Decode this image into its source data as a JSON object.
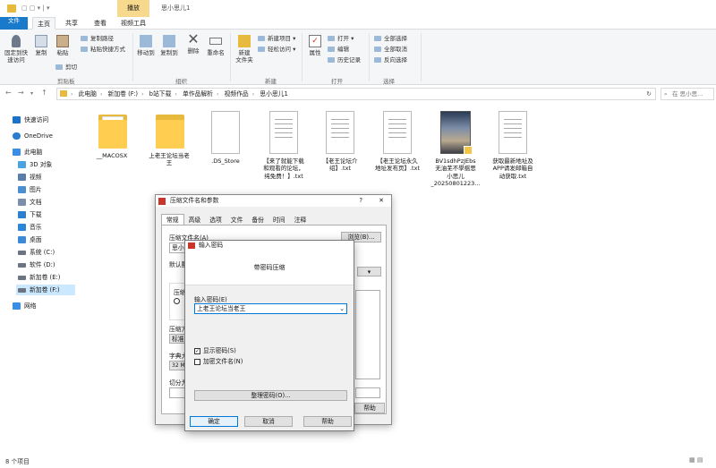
{
  "window": {
    "context_tab": "播放",
    "title": "思小思儿1"
  },
  "ribbon_tabs": [
    "文件",
    "主页",
    "共享",
    "查看",
    "视频工具"
  ],
  "ribbon": {
    "clipboard": {
      "pin": "固定到快\n速访问",
      "copy": "复制",
      "paste": "粘贴",
      "copy_path": "复制路径",
      "paste_shortcut": "粘贴快捷方式",
      "cut": "剪切",
      "group": "剪贴板"
    },
    "organize": {
      "move_to": "移动到",
      "copy_to": "复制到",
      "delete": "删除",
      "rename": "重命名",
      "group": "组织"
    },
    "new": {
      "new_folder": "新建\n文件夹",
      "new_item": "新建项目 ▾",
      "easy_access": "轻松访问 ▾",
      "group": "新建"
    },
    "open": {
      "properties": "属性",
      "open": "打开 ▾",
      "edit": "编辑",
      "history": "历史记录",
      "group": "打开"
    },
    "select": {
      "select_all": "全部选择",
      "select_none": "全部取消",
      "invert": "反向选择",
      "group": "选择"
    }
  },
  "address": {
    "crumbs": [
      "此电脑",
      "新加卷 (F:)",
      "b站下载",
      "单作品解析",
      "视频作品",
      "思小思儿1"
    ],
    "search_placeholder": "在 思小思..."
  },
  "sidebar": [
    {
      "label": "快速访问",
      "icon": "star-icon",
      "color": "#1a73c8"
    },
    {
      "label": "OneDrive",
      "icon": "cloud-icon",
      "color": "#2b7cd3"
    },
    {
      "label": "此电脑",
      "icon": "computer-icon",
      "color": "#3a8ee6"
    },
    {
      "label": "3D 对象",
      "icon": "cube-icon",
      "color": "#4aa3e0"
    },
    {
      "label": "视频",
      "icon": "video-icon",
      "color": "#5a7ea8"
    },
    {
      "label": "图片",
      "icon": "picture-icon",
      "color": "#4c8fd0"
    },
    {
      "label": "文档",
      "icon": "document-icon",
      "color": "#7a8fa8"
    },
    {
      "label": "下载",
      "icon": "download-icon",
      "color": "#2a7fd0"
    },
    {
      "label": "音乐",
      "icon": "music-icon",
      "color": "#2a86d6"
    },
    {
      "label": "桌面",
      "icon": "desktop-icon",
      "color": "#3d8ad8"
    },
    {
      "label": "系统 (C:)",
      "icon": "drive-icon",
      "color": "#6b7480"
    },
    {
      "label": "软件 (D:)",
      "icon": "drive-icon",
      "color": "#6b7480"
    },
    {
      "label": "新加卷 (E:)",
      "icon": "drive-icon",
      "color": "#6b7480"
    },
    {
      "label": "新加卷 (F:)",
      "icon": "drive-icon",
      "color": "#6b7480"
    },
    {
      "label": "网络",
      "icon": "network-icon",
      "color": "#3a8ee6"
    }
  ],
  "files": [
    {
      "name": "__MACOSX",
      "kind": "folder"
    },
    {
      "name": "上老王论坛当老\n王",
      "kind": "folder"
    },
    {
      "name": ".DS_Store",
      "kind": "doc"
    },
    {
      "name": "【来了就能下载\n和观看的论坛，\n纯免费！】.txt",
      "kind": "doc"
    },
    {
      "name": "【老王论坛介\n绍】.txt",
      "kind": "doc"
    },
    {
      "name": "【老王论坛永久\n地址发布页】.txt",
      "kind": "doc"
    },
    {
      "name": "BV1sdhPzJEbs\n无油芜不學揺思\n小思儿\n_20250801223...",
      "kind": "video"
    },
    {
      "name": "获取最新地址及\nAPP请发邮箱自\n动获取.txt",
      "kind": "doc"
    }
  ],
  "status": "8 个项目",
  "archive_dialog": {
    "title": "压缩文件名和参数",
    "help_icon": "?",
    "tabs": [
      "常规",
      "高级",
      "选项",
      "文件",
      "备份",
      "时间",
      "注释"
    ],
    "archive_name_label": "压缩文件名(A)",
    "archive_name_value": "思小",
    "browse": "浏览(B)...",
    "default_label": "默认配",
    "format_label": "压缩",
    "method_label": "压缩方",
    "method_value": "标准",
    "dict_label": "字典大",
    "dict_value": "32 MB",
    "split_label": "切分为",
    "help": "帮助"
  },
  "password_dialog": {
    "title": "输入密码",
    "heading": "带密码压缩",
    "input_label": "输入密码(E)",
    "password_value": "上老王论坛当老王",
    "show_password": "显示密码(S)",
    "encrypt_names": "加密文件名(N)",
    "organize": "整理密码(O)...",
    "ok": "确定",
    "cancel": "取消",
    "help": "帮助"
  }
}
